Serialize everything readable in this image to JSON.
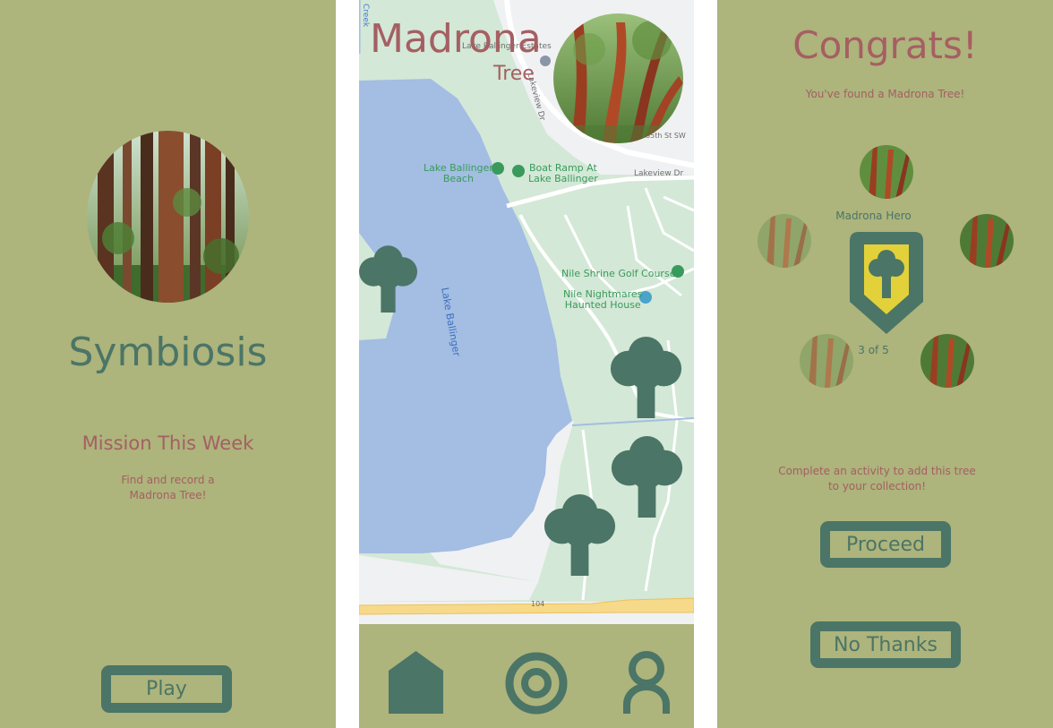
{
  "home": {
    "title": "Symbiosis",
    "mission_heading": "Mission This Week",
    "mission_line1": "Find and record a",
    "mission_line2": "Madrona Tree!",
    "play_label": "Play"
  },
  "map": {
    "title": "Madrona",
    "subtitle": "Tree",
    "labels": {
      "beach_l1": "Lake Ballinger",
      "beach_l2": "Beach",
      "boat_l1": "Boat Ramp At",
      "boat_l2": "Lake Ballinger",
      "golf": "Nile Shrine Golf Course",
      "haunted_l1": "Nile Nightmares",
      "haunted_l2": "Haunted House",
      "lake": "Lake Ballinger",
      "estates": "Lake Ballinger Estates",
      "lakeview_dr": "Lakeview Dr",
      "lakeview_dr2": "Lakeview Dr",
      "street_235": "235th St SW",
      "creek": "Creek",
      "route": "104"
    },
    "nav": [
      "home-icon",
      "target-icon",
      "profile-icon"
    ]
  },
  "congrats": {
    "title": "Congrats!",
    "found_text": "You've found a Madrona Tree!",
    "badge_name": "Madrona Hero",
    "progress_text": "3 of 5",
    "progress": {
      "current": 3,
      "total": 5
    },
    "activity_line1": "Complete an activity to add this tree",
    "activity_line2": "to your collection!",
    "proceed_label": "Proceed",
    "no_thanks_label": "No Thanks"
  },
  "colors": {
    "background": "#adb47c",
    "primary": "#4b7566",
    "accent": "#a55f62",
    "badge_fill": "#e3d13a",
    "water": "#a3bde3",
    "park": "#d3e8d6"
  }
}
